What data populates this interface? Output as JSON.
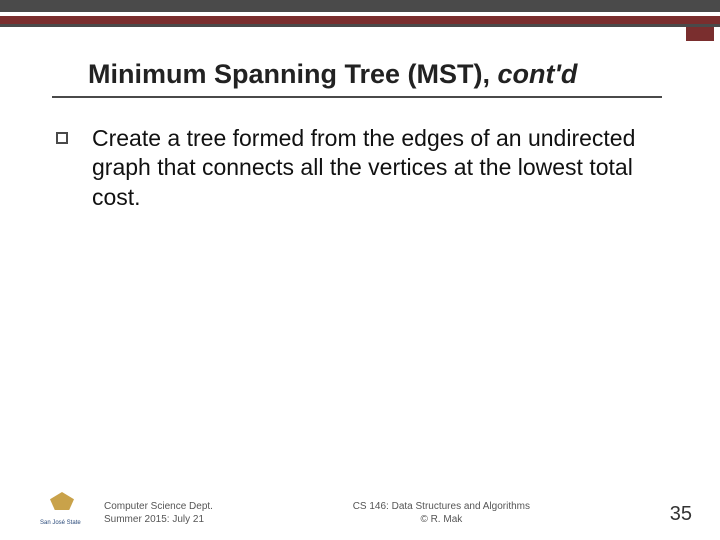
{
  "title": {
    "main": "Minimum Spanning Tree (MST), ",
    "tail": "cont'd"
  },
  "bullet": "Create a tree formed from the edges of an undirected graph that connects all the vertices at the lowest total cost.",
  "footer": {
    "left_line1": "Computer Science Dept.",
    "left_line2": "Summer 2015: July 21",
    "center_line1": "CS 146: Data Structures and Algorithms",
    "center_line2": "© R. Mak",
    "page": "35",
    "logo_label": "San José State"
  }
}
